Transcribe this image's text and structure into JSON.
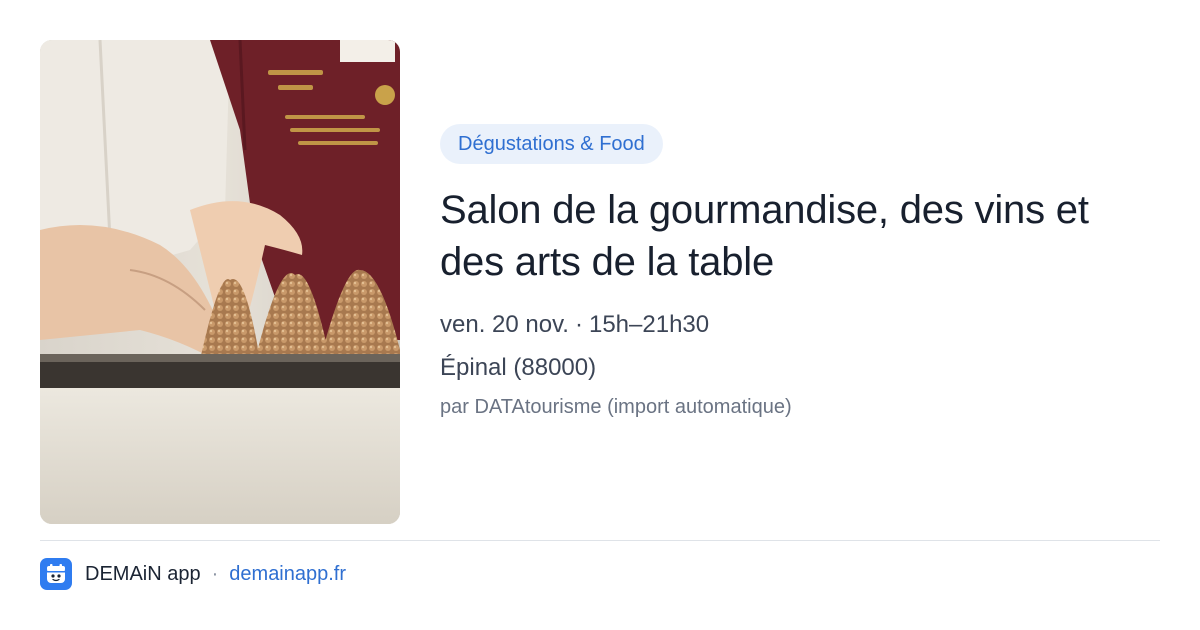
{
  "event": {
    "category": "Dégustations & Food",
    "title": "Salon de la gourmandise, des vins et des arts de la table",
    "date": "ven. 20 nov.",
    "time": "15h–21h30",
    "separator": "·",
    "location": "Épinal (88000)",
    "source": "par DATAtourisme (import automatique)",
    "image_icon": "event-photo-pastry-chef"
  },
  "footer": {
    "app_name": "DEMAiN app",
    "separator": "·",
    "link": "demainapp.fr",
    "icon": "demain-app-logo-icon"
  },
  "colors": {
    "accent": "#2f6fd1",
    "badge_bg": "#eaf1fb",
    "title": "#18202e",
    "meta": "#3c4556",
    "source": "#6a7383",
    "divider": "#dfe3e8",
    "app_icon_bg": "#2f7cf0"
  }
}
